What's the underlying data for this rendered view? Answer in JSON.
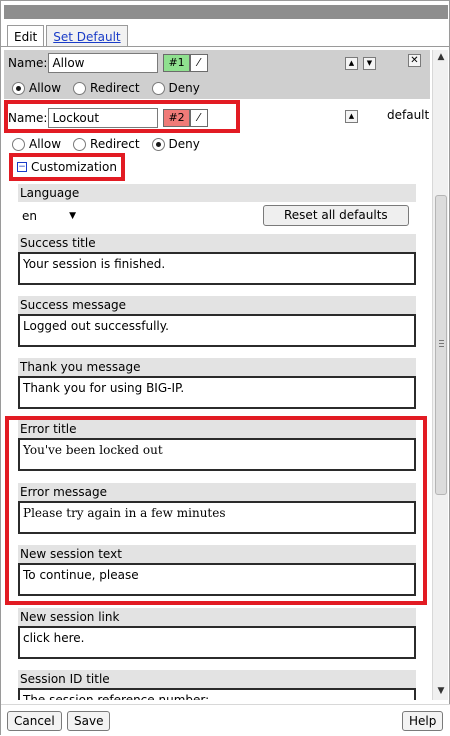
{
  "tabs": [
    {
      "label": "Edit"
    },
    {
      "label": "Set Default"
    }
  ],
  "rule1": {
    "name_label": "Name:",
    "name_value": "Allow",
    "badge": "#1",
    "badge_color": "#8fe08f",
    "actions": {
      "allow": "Allow",
      "redirect": "Redirect",
      "deny": "Deny"
    },
    "selected": "allow"
  },
  "rule2": {
    "name_label": "Name:",
    "name_value": "Lockout",
    "badge": "#2",
    "badge_color": "#f07b78",
    "default_label": "default",
    "actions": {
      "allow": "Allow",
      "redirect": "Redirect",
      "deny": "Deny"
    },
    "selected": "deny",
    "customization_label": "Customization"
  },
  "customization": {
    "language_label": "Language",
    "language_value": "en",
    "reset_button": "Reset all defaults",
    "fields": [
      {
        "label": "Success title",
        "value": "Your session is finished."
      },
      {
        "label": "Success message",
        "value": "Logged out successfully."
      },
      {
        "label": "Thank you message",
        "value": "Thank you for using BIG-IP."
      },
      {
        "label": "Error title",
        "value": "You've been locked out"
      },
      {
        "label": "Error message",
        "value": "Please try again in a few minutes"
      },
      {
        "label": "New session text",
        "value": "To continue, please"
      },
      {
        "label": "New session link",
        "value": "click here."
      },
      {
        "label": "Session ID title",
        "value": "The session reference number:"
      }
    ]
  },
  "footer": {
    "cancel": "Cancel",
    "save": "Save",
    "help": "Help"
  },
  "colors": {
    "highlight": "#e21b23",
    "link": "#1a3cc8"
  }
}
